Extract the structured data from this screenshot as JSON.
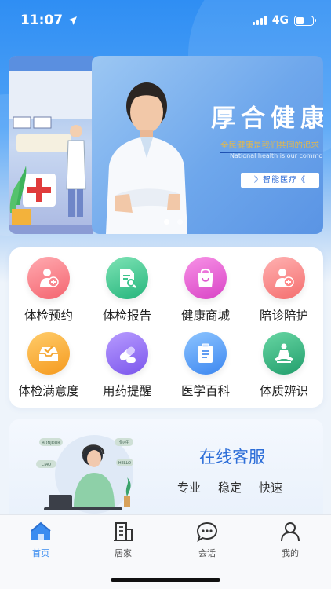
{
  "status": {
    "time": "11:07",
    "network": "4G"
  },
  "banner": {
    "title": "厚合健康",
    "subtitle_cn": "全民健康是我们共同的追求",
    "subtitle_en": "National health is our common pursuit",
    "button": "》智能医疗《"
  },
  "services": [
    {
      "label": "体检预约",
      "icon": "person-plus-icon"
    },
    {
      "label": "体检报告",
      "icon": "report-search-icon"
    },
    {
      "label": "健康商城",
      "icon": "shopping-bag-icon"
    },
    {
      "label": "陪诊陪护",
      "icon": "person-plus-icon"
    },
    {
      "label": "体检满意度",
      "icon": "inbox-check-icon"
    },
    {
      "label": "用药提醒",
      "icon": "pill-icon"
    },
    {
      "label": "医学百科",
      "icon": "clipboard-icon"
    },
    {
      "label": "体质辨识",
      "icon": "meditation-icon"
    }
  ],
  "customer_service": {
    "title": "在线客服",
    "tags": [
      "专业",
      "稳定",
      "快速"
    ],
    "bubbles": [
      "BONJOUR",
      "你好",
      "HELLO",
      "CIAO"
    ]
  },
  "tabbar": [
    {
      "label": "首页",
      "icon": "home-icon",
      "active": true
    },
    {
      "label": "居家",
      "icon": "building-icon",
      "active": false
    },
    {
      "label": "会话",
      "icon": "chat-icon",
      "active": false
    },
    {
      "label": "我的",
      "icon": "user-icon",
      "active": false
    }
  ],
  "colors": {
    "accent": "#3a8cf0",
    "brand_blue": "#2d6ed8"
  }
}
